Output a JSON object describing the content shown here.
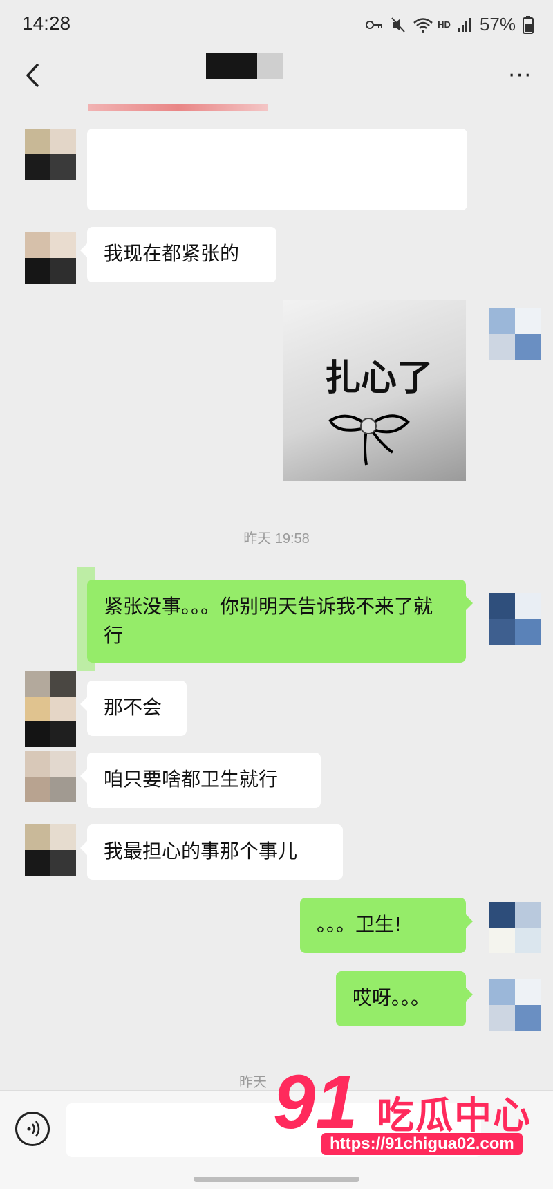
{
  "status_bar": {
    "time": "14:28",
    "network": "HD",
    "battery": "57%"
  },
  "nav": {
    "back_icon": "chevron-left-icon",
    "more_icon": "more-dots-icon",
    "more_label": "···"
  },
  "messages": [
    {
      "side": "left",
      "text": "我现在都紧张的"
    },
    {
      "side": "right",
      "type": "sticker",
      "sticker_text": "扎心了"
    },
    {
      "side": "right",
      "text": "紧张没事。。。你别明天告诉我不来了就行"
    },
    {
      "side": "left",
      "text": "那不会"
    },
    {
      "side": "left",
      "text": "咱只要啥都卫生就行"
    },
    {
      "side": "left",
      "text": "我最担心的事那个事儿"
    },
    {
      "side": "right",
      "text": "。。。卫生!"
    },
    {
      "side": "right",
      "text": "哎呀。。。"
    }
  ],
  "timestamps": [
    "昨天 19:58",
    "昨天"
  ],
  "watermark": {
    "number": "91",
    "chinese": "吃瓜中心",
    "url": "https://91chigua02.com"
  },
  "input_bar": {
    "voice_icon": "voice-icon"
  },
  "colors": {
    "green_bubble": "#95ec69",
    "white_bubble": "#ffffff",
    "background": "#ededed",
    "watermark": "#ff2a5c"
  }
}
